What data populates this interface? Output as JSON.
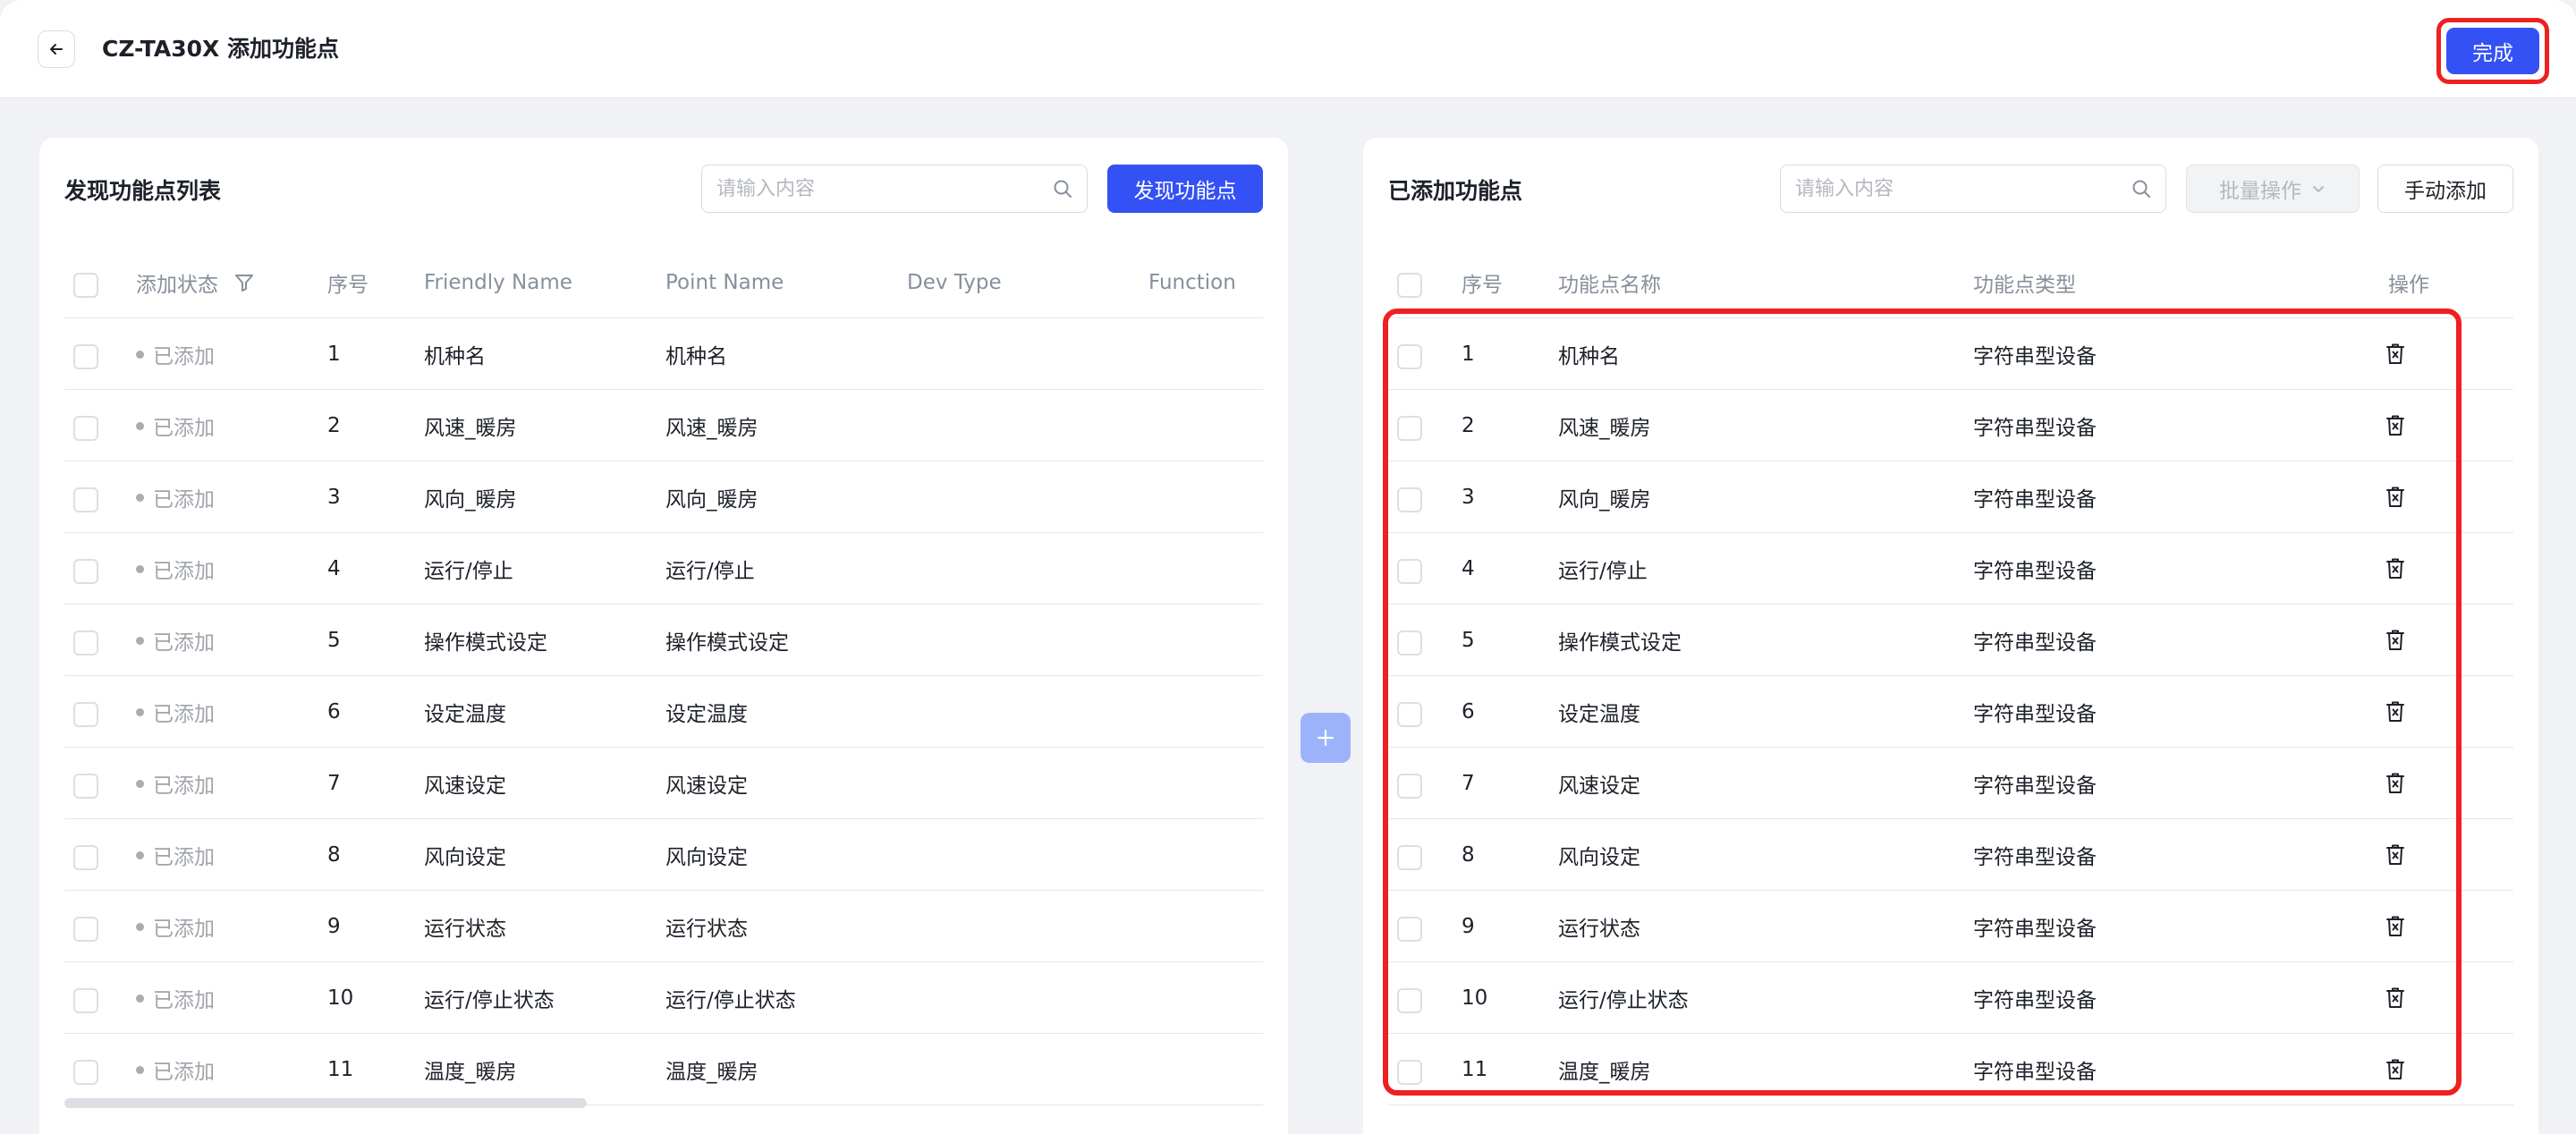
{
  "header": {
    "title": "CZ-TA30X 添加功能点",
    "done_label": "完成"
  },
  "left_panel": {
    "title": "发现功能点列表",
    "search_placeholder": "请输入内容",
    "discover_label": "发现功能点",
    "columns": {
      "status": "添加状态",
      "index": "序号",
      "friendly_name": "Friendly Name",
      "point_name": "Point Name",
      "dev_type": "Dev Type",
      "function": "Function"
    },
    "rows": [
      {
        "status": "已添加",
        "index": "1",
        "friendly_name": "机种名",
        "point_name": "机种名"
      },
      {
        "status": "已添加",
        "index": "2",
        "friendly_name": "风速_暖房",
        "point_name": "风速_暖房"
      },
      {
        "status": "已添加",
        "index": "3",
        "friendly_name": "风向_暖房",
        "point_name": "风向_暖房"
      },
      {
        "status": "已添加",
        "index": "4",
        "friendly_name": "运行/停止",
        "point_name": "运行/停止"
      },
      {
        "status": "已添加",
        "index": "5",
        "friendly_name": "操作模式设定",
        "point_name": "操作模式设定"
      },
      {
        "status": "已添加",
        "index": "6",
        "friendly_name": "设定温度",
        "point_name": "设定温度"
      },
      {
        "status": "已添加",
        "index": "7",
        "friendly_name": "风速设定",
        "point_name": "风速设定"
      },
      {
        "status": "已添加",
        "index": "8",
        "friendly_name": "风向设定",
        "point_name": "风向设定"
      },
      {
        "status": "已添加",
        "index": "9",
        "friendly_name": "运行状态",
        "point_name": "运行状态"
      },
      {
        "status": "已添加",
        "index": "10",
        "friendly_name": "运行/停止状态",
        "point_name": "运行/停止状态"
      },
      {
        "status": "已添加",
        "index": "11",
        "friendly_name": "温度_暖房",
        "point_name": "温度_暖房"
      }
    ]
  },
  "right_panel": {
    "title": "已添加功能点",
    "search_placeholder": "请输入内容",
    "batch_label": "批量操作",
    "manual_add_label": "手动添加",
    "columns": {
      "index": "序号",
      "name": "功能点名称",
      "type": "功能点类型",
      "action": "操作"
    },
    "rows": [
      {
        "index": "1",
        "name": "机种名",
        "type": "字符串型设备"
      },
      {
        "index": "2",
        "name": "风速_暖房",
        "type": "字符串型设备"
      },
      {
        "index": "3",
        "name": "风向_暖房",
        "type": "字符串型设备"
      },
      {
        "index": "4",
        "name": "运行/停止",
        "type": "字符串型设备"
      },
      {
        "index": "5",
        "name": "操作模式设定",
        "type": "字符串型设备"
      },
      {
        "index": "6",
        "name": "设定温度",
        "type": "字符串型设备"
      },
      {
        "index": "7",
        "name": "风速设定",
        "type": "字符串型设备"
      },
      {
        "index": "8",
        "name": "风向设定",
        "type": "字符串型设备"
      },
      {
        "index": "9",
        "name": "运行状态",
        "type": "字符串型设备"
      },
      {
        "index": "10",
        "name": "运行/停止状态",
        "type": "字符串型设备"
      },
      {
        "index": "11",
        "name": "温度_暖房",
        "type": "字符串型设备"
      }
    ]
  },
  "icons": {
    "back": "arrow-left-icon",
    "search": "search-icon",
    "filter": "filter-icon",
    "chevron": "chevron-down-icon",
    "delete": "trash-icon",
    "add": "plus-icon"
  },
  "colors": {
    "primary": "#3451f5",
    "highlight": "#ee2020",
    "transfer_button": "#9cb2fb"
  }
}
